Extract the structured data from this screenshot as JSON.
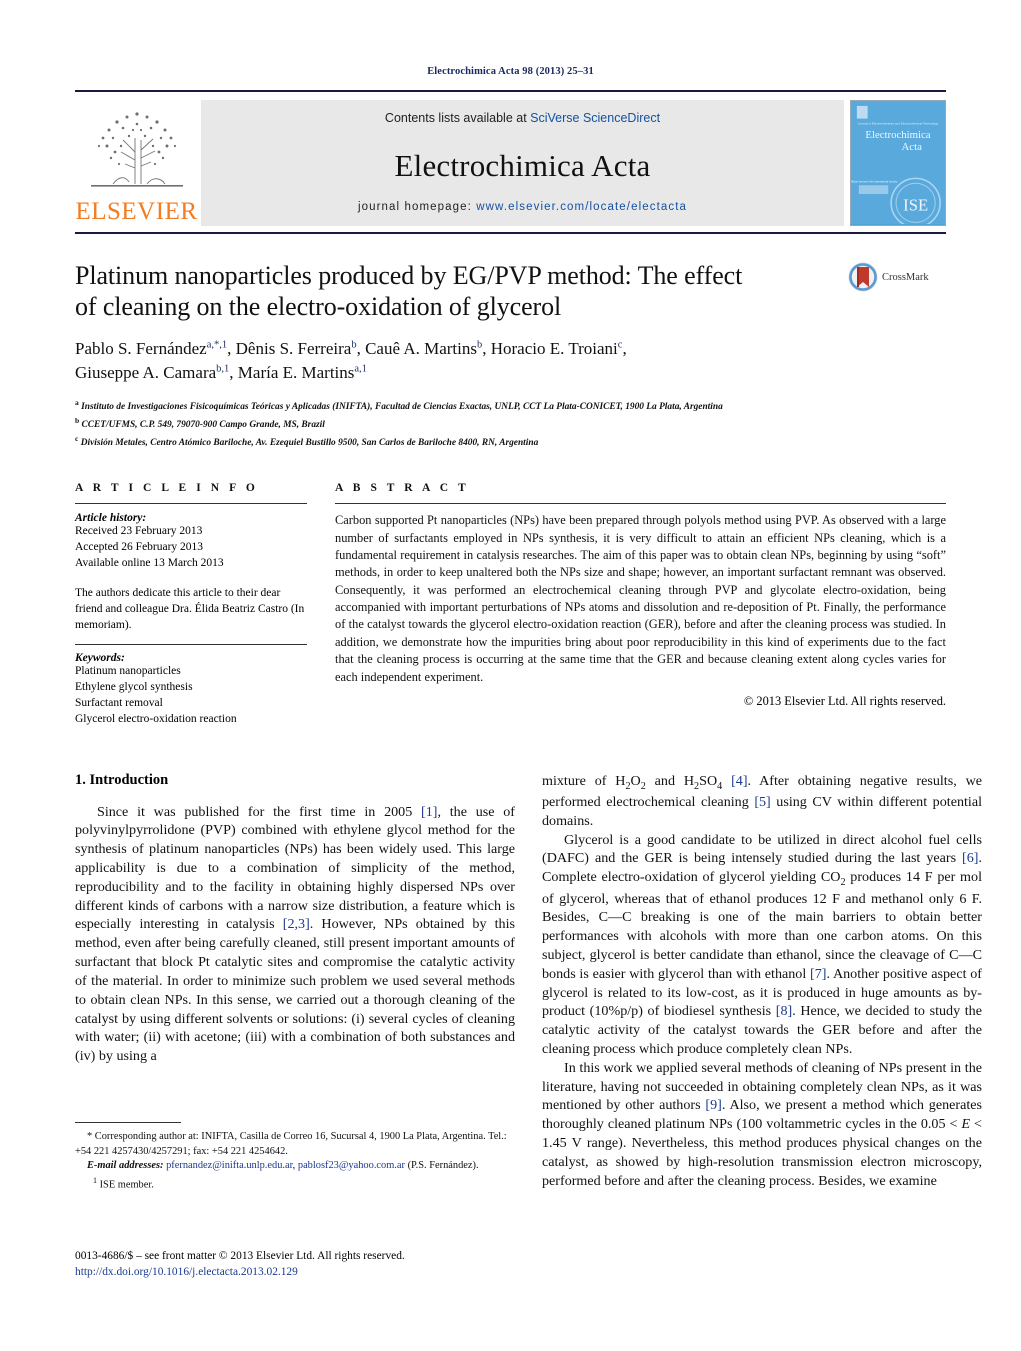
{
  "running_head": "Electrochimica Acta 98 (2013) 25–31",
  "masthead": {
    "contents_prefix": "Contents lists available at ",
    "contents_link": "SciVerse ScienceDirect",
    "journal_name": "Electrochimica Acta",
    "homepage_prefix": "journal homepage: ",
    "homepage_url": "www.elsevier.com/locate/electacta",
    "publisher_logo_text": "ELSEVIER",
    "cover_title_line1": "Electrochimica",
    "cover_title_line2": "Acta",
    "cover_tagline": "Journal of Electrochemistry and Electrochemical Technology",
    "cover_badge": "ISE"
  },
  "crossmark": {
    "label": "CrossMark"
  },
  "article": {
    "title_line1": "Platinum nanoparticles produced by EG/PVP method: The effect",
    "title_line2": "of cleaning on the electro-oxidation of glycerol",
    "authors_line1": "Pablo S. Fernández",
    "authors_line1_sup": "a,*,1",
    "authors": [
      {
        "name": "Pablo S. Fernández",
        "sup": "a,*,1"
      },
      {
        "name": "Dênis S. Ferreira",
        "sup": "b"
      },
      {
        "name": "Cauê A. Martins",
        "sup": "b"
      },
      {
        "name": "Horacio E. Troiani",
        "sup": "c"
      },
      {
        "name": "Giuseppe A. Camara",
        "sup": "b,1"
      },
      {
        "name": "María E. Martins",
        "sup": "a,1"
      }
    ],
    "affiliations": [
      {
        "mark": "a",
        "text": "Instituto de Investigaciones Fisicoquímicas Teóricas y Aplicadas (INIFTA), Facultad de Ciencias Exactas, UNLP, CCT La Plata-CONICET, 1900 La Plata, Argentina"
      },
      {
        "mark": "b",
        "text": "CCET/UFMS, C.P. 549, 79070-900 Campo Grande, MS, Brazil"
      },
      {
        "mark": "c",
        "text": "División Metales, Centro Atómico Bariloche, Av. Ezequiel Bustillo 9500, San Carlos de Bariloche 8400, RN, Argentina"
      }
    ]
  },
  "article_info": {
    "heading": "A R T I C L E    I N F O",
    "history_label": "Article history:",
    "history": [
      "Received 23 February 2013",
      "Accepted 26 February 2013",
      "Available online 13 March 2013"
    ],
    "dedication": "The authors dedicate this article to their dear friend and colleague Dra. Élida Beatriz Castro (In memoriam).",
    "keywords_label": "Keywords:",
    "keywords": [
      "Platinum nanoparticles",
      "Ethylene glycol synthesis",
      "Surfactant removal",
      "Glycerol electro-oxidation reaction"
    ]
  },
  "abstract": {
    "heading": "A B S T R A C T",
    "text": "Carbon supported Pt nanoparticles (NPs) have been prepared through polyols method using PVP. As observed with a large number of surfactants employed in NPs synthesis, it is very difficult to attain an efficient NPs cleaning, which is a fundamental requirement in catalysis researches. The aim of this paper was to obtain clean NPs, beginning by using “soft” methods, in order to keep unaltered both the NPs size and shape; however, an important surfactant remnant was observed. Consequently, it was performed an electrochemical cleaning through PVP and glycolate electro-oxidation, being accompanied with important perturbations of NPs atoms and dissolution and re-deposition of Pt. Finally, the performance of the catalyst towards the glycerol electro-oxidation reaction (GER), before and after the cleaning process was studied. In addition, we demonstrate how the impurities bring about poor reproducibility in this kind of experiments due to the fact that the cleaning process is occurring at the same time that the GER and because cleaning extent along cycles varies for each independent experiment.",
    "copyright": "© 2013 Elsevier Ltd. All rights reserved."
  },
  "body": {
    "section_number_title": "1.  Introduction",
    "left_para_1_a": "Since it was published for the first time in 2005 ",
    "left_para_1_ref1": "[1]",
    "left_para_1_b": ", the use of polyvinylpyrrolidone (PVP) combined with ethylene glycol method for the synthesis of platinum nanoparticles (NPs) has been widely used. This large applicability is due to a combination of simplicity of the method, reproducibility and to the facility in obtaining highly dispersed NPs over different kinds of carbons with a narrow size distribution, a feature which is especially interesting in catalysis ",
    "left_para_1_ref2": "[2,3]",
    "left_para_1_c": ". However, NPs obtained by this method, even after being carefully cleaned, still present important amounts of surfactant that block Pt catalytic sites and compromise the catalytic activity of the material. In order to minimize such problem we used several methods to obtain clean NPs. In this sense, we carried out a thorough cleaning of the catalyst by using different solvents or solutions: (i) several cycles of cleaning with water; (ii) with acetone; (iii) with a combination of both substances and (iv) by using a",
    "right_para_0_a": "mixture of H",
    "right_para_0_sub1": "2",
    "right_para_0_b": "O",
    "right_para_0_sub2": "2",
    "right_para_0_c": " and H",
    "right_para_0_sub3": "2",
    "right_para_0_d": "SO",
    "right_para_0_sub4": "4",
    "right_para_0_ref4": "[4]",
    "right_para_0_e": ". After obtaining negative results, we performed electrochemical cleaning ",
    "right_para_0_ref5": "[5]",
    "right_para_0_f": " using CV within different potential domains.",
    "right_para_1_a": "Glycerol is a good candidate to be utilized in direct alcohol fuel cells (DAFC) and the GER is being intensely studied during the last years ",
    "right_para_1_ref6": "[6]",
    "right_para_1_b": ". Complete electro-oxidation of glycerol yielding CO",
    "right_para_1_sub": "2",
    "right_para_1_c": " produces 14 F per mol of glycerol, whereas that of ethanol produces 12 F and methanol only 6 F. Besides, C—C breaking is one of the main barriers to obtain better performances with alcohols with more than one carbon atoms. On this subject, glycerol is better candidate than ethanol, since the cleavage of C—C bonds is easier with glycerol than with ethanol ",
    "right_para_1_ref7": "[7]",
    "right_para_1_d": ". Another positive aspect of glycerol is related to its low-cost, as it is produced in huge amounts as by-product (10%p/p) of biodiesel synthesis ",
    "right_para_1_ref8": "[8]",
    "right_para_1_e": ". Hence, we decided to study the catalytic activity of the catalyst towards the GER before and after the cleaning process which produce completely clean NPs.",
    "right_para_2_a": "In this work we applied several methods of cleaning of NPs present in the literature, having not succeeded in obtaining completely clean NPs, as it was mentioned by other authors ",
    "right_para_2_ref9": "[9]",
    "right_para_2_b": ". Also, we present a method which generates thoroughly cleaned platinum NPs (100 voltammetric cycles in the 0.05 < ",
    "right_para_2_italic_E": "E",
    "right_para_2_c": " < 1.45 V range). Nevertheless, this method produces physical changes on the catalyst, as showed by high-resolution transmission electron microscopy, performed before and after the cleaning process. Besides, we examine"
  },
  "footnotes": {
    "corresponding_mark": "*",
    "corresponding": " Corresponding author at: INIFTA, Casilla de Correo 16, Sucursal 4, 1900 La Plata, Argentina. Tel.: +54 221 4257430/4257291; fax: +54 221 4254642.",
    "email_label": "E-mail addresses:",
    "email_1": "pfernandez@inifta.unlp.edu.ar",
    "email_sep": ", ",
    "email_2": "pablosf23@yahoo.com.ar",
    "email_owner": "(P.S. Fernández).",
    "ise_mark": "1",
    "ise_note": " ISE member."
  },
  "issn": {
    "line1": "0013-4686/$ – see front matter © 2013 Elsevier Ltd. All rights reserved.",
    "doi": "http://dx.doi.org/10.1016/j.electacta.2013.02.129"
  },
  "colors": {
    "link": "#1452a0",
    "ref": "#1a3a8f",
    "elsevier_orange": "#F47B20",
    "cover_blue": "#4fa3d9",
    "running_head": "#1a2a5e"
  }
}
